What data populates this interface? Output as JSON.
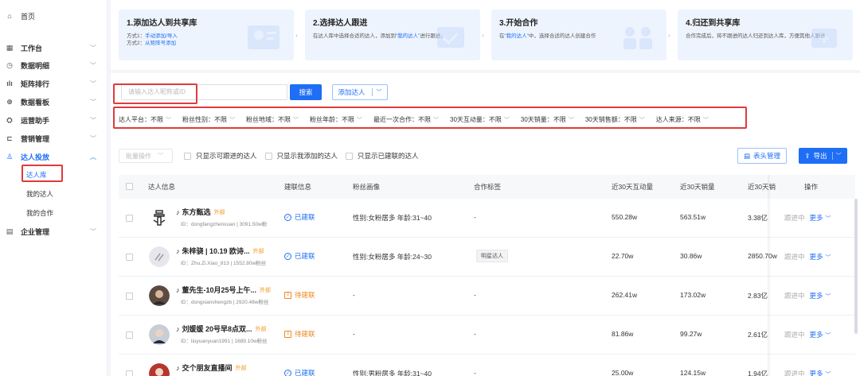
{
  "sidebar": {
    "home": {
      "label": "首页",
      "icon": "home-icon"
    },
    "items": [
      {
        "label": "工作台",
        "icon": "grid-icon"
      },
      {
        "label": "数据明细",
        "icon": "clock-icon"
      },
      {
        "label": "矩阵排行",
        "icon": "bar-chart-icon"
      },
      {
        "label": "数据看板",
        "icon": "dashboard-icon"
      },
      {
        "label": "运营助手",
        "icon": "assistant-icon"
      },
      {
        "label": "营销管理",
        "icon": "marketing-icon"
      },
      {
        "label": "达人投放",
        "icon": "user-icon"
      }
    ],
    "subitems": [
      "达人库",
      "我的达人",
      "我的合作"
    ],
    "enterprise": {
      "label": "企业管理",
      "icon": "enterprise-icon"
    }
  },
  "steps": [
    {
      "title": "1.添加达人到共享库",
      "line1_prefix": "方式1：",
      "line1_link": "手动添加/导入",
      "line2_prefix": "方式2：",
      "line2_link": "从矩阵号添加"
    },
    {
      "title": "2.选择达人跟进",
      "text": "在达人库中选择合适的达人，添加到",
      "link": "“我的达人”",
      "text2": "进行跟进。"
    },
    {
      "title": "3.开始合作",
      "text": "在",
      "link": "“我的达人”",
      "text2": "中，选择合适的达人创建合作"
    },
    {
      "title": "4.归还到共享库",
      "text": "合作完成后，将不跟进的达人归还到达人库，方便其他人跟进"
    }
  ],
  "search": {
    "placeholder": "请输入达人昵称或ID",
    "button": "搜索",
    "add_button": "添加达人"
  },
  "filters": [
    {
      "label": "达人平台：",
      "value": "不限"
    },
    {
      "label": "粉丝性别：",
      "value": "不限"
    },
    {
      "label": "粉丝地域：",
      "value": "不限"
    },
    {
      "label": "粉丝年龄：",
      "value": "不限"
    },
    {
      "label": "最近一次合作：",
      "value": "不限"
    },
    {
      "label": "30天互动量：",
      "value": "不限"
    },
    {
      "label": "30天销量：",
      "value": "不限"
    },
    {
      "label": "30天销售额：",
      "value": "不限"
    },
    {
      "label": "达人来源：",
      "value": "不限"
    }
  ],
  "toolbar": {
    "batch": "批量操作",
    "checks": [
      "只显示可跟进的达人",
      "只显示我添加的达人",
      "只显示已建联的达人"
    ],
    "columns_button": "表头管理",
    "export_button": "导出"
  },
  "table": {
    "headers": [
      "达人信息",
      "建联信息",
      "粉丝画像",
      "合作标签",
      "近30天互动量",
      "近30天销量",
      "近30天销",
      "操作"
    ],
    "rows": [
      {
        "name": "东方甄选",
        "ext": "外部",
        "id": "ID：dongfangzhenxuan | 3091.50w粉",
        "status": "已建联",
        "status_type": "ok",
        "portrait": "性别:女粉居多 年龄:31~40",
        "tag": "",
        "interact": "550.28w",
        "sales": "563.51w",
        "amount": "3.38亿",
        "follow": "跟进中",
        "more": "更多"
      },
      {
        "name": "朱梓骁 | 10.19 欧诗...",
        "ext": "外部",
        "id": "ID：Zhu.Zi.Xiao_813 | 1552.80w粉丝",
        "status": "已建联",
        "status_type": "ok",
        "portrait": "性别:女粉居多 年龄:24~30",
        "tag": "明星达人",
        "interact": "22.70w",
        "sales": "30.86w",
        "amount": "2850.70w",
        "follow": "跟进中",
        "more": "更多"
      },
      {
        "name": "董先生-10月25号上午...",
        "ext": "外部",
        "id": "ID：dongxianshengzb | 2920.48w粉丝",
        "status": "待建联",
        "status_type": "pending",
        "portrait": "-",
        "tag": "-",
        "interact": "262.41w",
        "sales": "173.02w",
        "amount": "2.83亿",
        "follow": "跟进中",
        "more": "更多"
      },
      {
        "name": "刘媛媛 20号早8点双...",
        "ext": "外部",
        "id": "ID：liuyuanyuan1991 | 1689.10w粉丝",
        "status": "待建联",
        "status_type": "pending",
        "portrait": "-",
        "tag": "-",
        "interact": "81.86w",
        "sales": "99.27w",
        "amount": "2.61亿",
        "follow": "跟进中",
        "more": "更多"
      },
      {
        "name": "交个朋友直播间",
        "ext": "外部",
        "id": "ID：JGPYZBJ | 2176.52w粉丝",
        "status": "已建联",
        "status_type": "ok",
        "portrait": "性别:男粉居多 年龄:31~40",
        "tag": "-",
        "interact": "25.00w",
        "sales": "124.15w",
        "amount": "1.94亿",
        "follow": "跟进中",
        "more": "更多"
      }
    ]
  },
  "colors": {
    "accent": "#1e6ef6",
    "highlight": "#e03a3a",
    "pending": "#f08a24",
    "external": "#f59a23"
  }
}
